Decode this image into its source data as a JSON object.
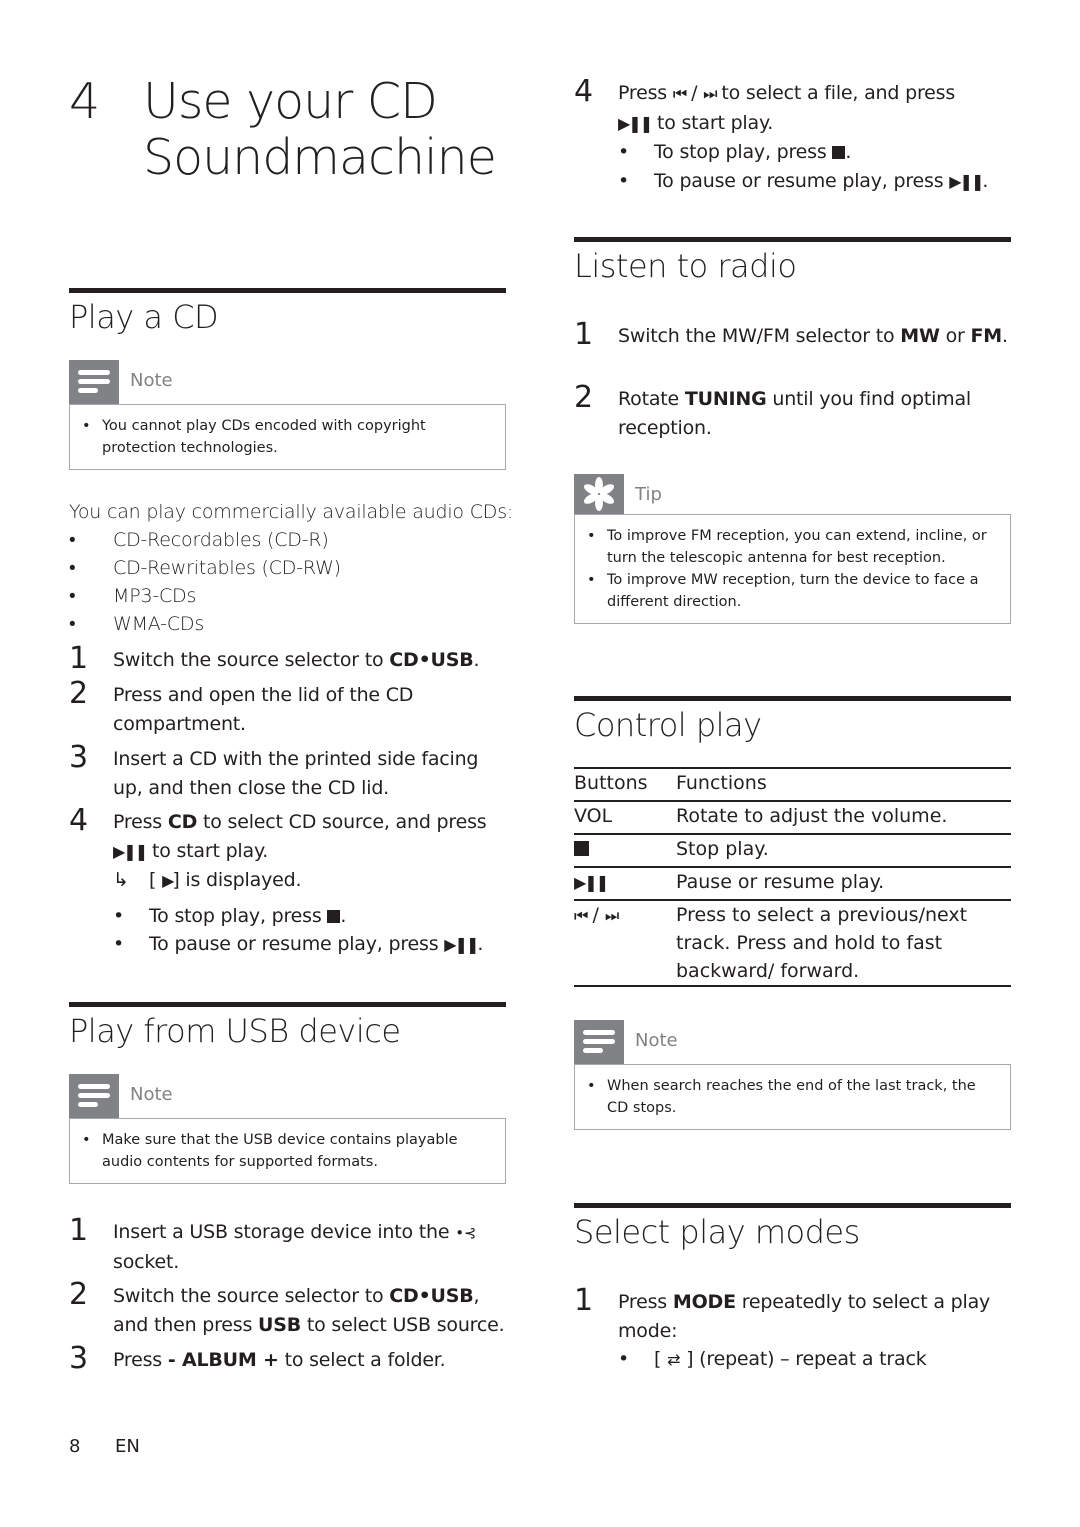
{
  "chapter": {
    "number": "4",
    "title_line1": "Use your CD",
    "title_line2": "Soundmachine"
  },
  "play_cd": {
    "title": "Play a CD",
    "note": {
      "label": "Note",
      "icon": "note-icon",
      "items": [
        "You cannot play CDs encoded with copyright protection technologies."
      ]
    },
    "intro": "You can play commercially available audio CDs:",
    "formats": [
      "CD-Recordables (CD-R)",
      "CD-Rewritables (CD-RW)",
      "MP3-CDs",
      "WMA-CDs"
    ],
    "steps": [
      {
        "n": "1",
        "pre": "Switch the source selector to ",
        "bold": "CD•USB",
        "post": "."
      },
      {
        "n": "2",
        "text": "Press and open the lid of the CD compartment."
      },
      {
        "n": "3",
        "text": "Insert a CD with the printed side facing up, and then close the CD lid."
      },
      {
        "n": "4",
        "pre": "Press ",
        "bold": "CD",
        "post": " to select CD source, and press",
        "line2": " to start play.",
        "result": "] is displayed.",
        "result_pre": "[ ",
        "sub": [
          "To stop play, press ",
          "To pause or resume play, press "
        ]
      }
    ]
  },
  "play_usb": {
    "title": "Play from USB device",
    "note": {
      "label": "Note",
      "icon": "note-icon",
      "items": [
        "Make sure that the USB device contains playable audio contents for supported formats."
      ]
    },
    "steps": [
      {
        "n": "1",
        "text": "Insert a USB storage device into the ",
        "post": "socket."
      },
      {
        "n": "2",
        "pre": "Switch the source selector to ",
        "bold": "CD•USB",
        "mid": ", and then press ",
        "bold2": "USB",
        "post": " to select USB source."
      },
      {
        "n": "3",
        "pre": "Press ",
        "bold": "- ALBUM +",
        "post": " to select a folder."
      },
      {
        "n": "4",
        "pre": "Press ",
        "mid": " / ",
        "post": " to select a file, and press",
        "line2": " to start play.",
        "sub": [
          "To stop play, press ",
          "To pause or resume play, press "
        ]
      }
    ]
  },
  "radio": {
    "title": "Listen to radio",
    "steps": [
      {
        "n": "1",
        "pre": "Switch the MW/FM selector to ",
        "bold": "MW",
        "mid": " or ",
        "bold2": "FM",
        "post": "."
      },
      {
        "n": "2",
        "pre": "Rotate ",
        "bold": "TUNING",
        "post": " until you find optimal reception."
      }
    ],
    "tip": {
      "label": "Tip",
      "icon": "tip-icon",
      "items": [
        "To improve FM reception, you can extend, incline, or turn the telescopic antenna for best reception.",
        "To improve MW reception, turn the device to face a different direction."
      ]
    }
  },
  "control": {
    "title": "Control play",
    "headers": [
      "Buttons",
      "Functions"
    ],
    "rows": [
      {
        "button": "VOL",
        "icon": "",
        "function": "Rotate to adjust the volume."
      },
      {
        "button": "",
        "icon": "stop-icon",
        "function": "Stop play."
      },
      {
        "button": "",
        "icon": "play-pause-icon",
        "function": "Pause or resume play."
      },
      {
        "button": " / ",
        "icon": "prev-next-icon",
        "function": "Press to select a previous/next track. Press and hold to fast backward/ forward."
      }
    ],
    "note": {
      "label": "Note",
      "icon": "note-icon",
      "items": [
        "When search reaches the end of the last track, the CD stops."
      ]
    }
  },
  "modes": {
    "title": "Select play modes",
    "steps": [
      {
        "n": "1",
        "pre": "Press ",
        "bold": "MODE",
        "post": " repeatedly to select a play mode:",
        "sub": [
          {
            "pre": "[ ",
            "post": " ] (repeat) – repeat a track",
            "icon": "repeat-icon"
          }
        ]
      }
    ]
  },
  "footer": {
    "page": "8",
    "lang": "EN"
  }
}
